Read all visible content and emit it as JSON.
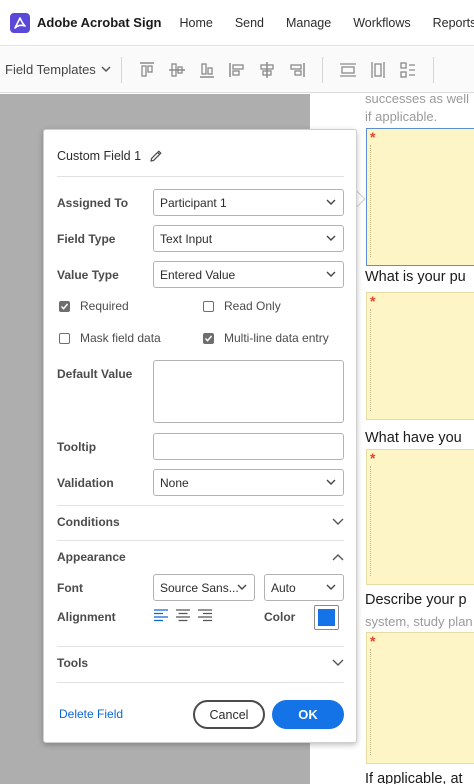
{
  "nav": {
    "brand": "Adobe Acrobat Sign",
    "links": [
      "Home",
      "Send",
      "Manage",
      "Workflows",
      "Reports"
    ]
  },
  "toolbar": {
    "field_templates": "Field Templates",
    "icons": [
      "align-top-icon",
      "align-middle-icon",
      "align-bottom-icon",
      "align-left-icon",
      "align-center-icon",
      "align-right-icon",
      "distribute-horizontal-icon",
      "distribute-vertical-icon",
      "arrange-icon"
    ]
  },
  "document": {
    "lines": [
      "successes as well",
      "if applicable."
    ],
    "questions": [
      "What is your pu",
      "What have you",
      "Describe your p",
      "If applicable, at"
    ],
    "subtext": "system, study plan",
    "required_marker": "*"
  },
  "panel": {
    "title": "Custom Field 1",
    "assigned_to_label": "Assigned To",
    "assigned_to_value": "Participant 1",
    "field_type_label": "Field Type",
    "field_type_value": "Text Input",
    "value_type_label": "Value Type",
    "value_type_value": "Entered Value",
    "required_label": "Required",
    "required_checked": true,
    "read_only_label": "Read Only",
    "read_only_checked": false,
    "mask_label": "Mask field data",
    "mask_checked": false,
    "multiline_label": "Multi-line data entry",
    "multiline_checked": true,
    "default_value_label": "Default Value",
    "default_value": "",
    "tooltip_label": "Tooltip",
    "tooltip_value": "",
    "validation_label": "Validation",
    "validation_value": "None",
    "conditions_label": "Conditions",
    "appearance_label": "Appearance",
    "font_label": "Font",
    "font_value": "Source Sans...",
    "font_size_value": "Auto",
    "alignment_label": "Alignment",
    "color_label": "Color",
    "color_value": "#1473e6",
    "tools_label": "Tools",
    "delete_label": "Delete Field",
    "cancel_label": "Cancel",
    "ok_label": "OK"
  }
}
